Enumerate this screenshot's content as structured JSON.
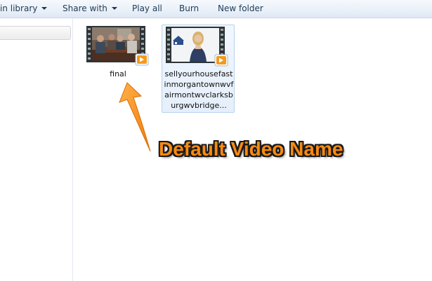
{
  "toolbar": {
    "library_label": "in library",
    "share_label": "Share with",
    "play_label": "Play all",
    "burn_label": "Burn",
    "new_folder_label": "New folder"
  },
  "files": [
    {
      "name": "final",
      "type": "video",
      "selected": false
    },
    {
      "name": "sellyourhousefastinmorgantownwvfairmontwvclarksburgwvbridge...",
      "type": "video",
      "selected": true
    }
  ],
  "annotation": {
    "text": "Default Video Name",
    "color": "#f78a12"
  },
  "colors": {
    "toolbar_text": "#1e3956",
    "selection_border": "#b8d2ee",
    "media_badge": "#f39a1c"
  }
}
